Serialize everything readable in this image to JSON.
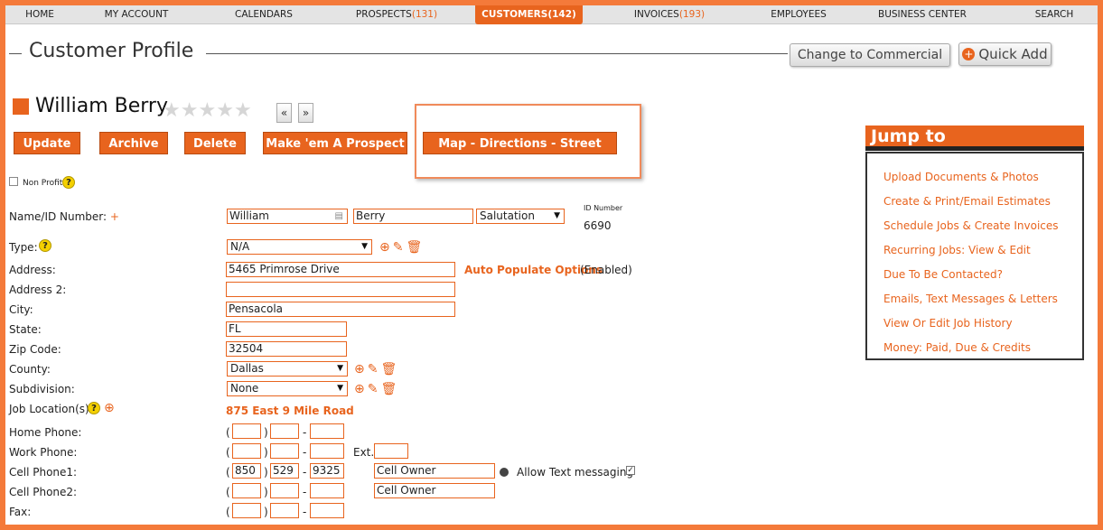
{
  "nav": {
    "items": [
      {
        "label": "HOME",
        "count": ""
      },
      {
        "label": "MY ACCOUNT",
        "count": ""
      },
      {
        "label": "CALENDARS",
        "count": ""
      },
      {
        "label": "PROSPECTS",
        "count": "(131)"
      },
      {
        "label": "CUSTOMERS",
        "count": "(142)"
      },
      {
        "label": "INVOICES",
        "count": "(193)"
      },
      {
        "label": "EMPLOYEES",
        "count": ""
      },
      {
        "label": "BUSINESS CENTER",
        "count": ""
      },
      {
        "label": "SEARCH",
        "count": ""
      }
    ],
    "active": "CUSTOMERS"
  },
  "page": {
    "title": "Customer Profile",
    "change_commercial_label": "Change to Commercial",
    "quick_add_label": "Quick Add"
  },
  "customer": {
    "name": "William Berry",
    "rating_stars": 0,
    "rating_max": 5,
    "prev_label": "«",
    "next_label": "»"
  },
  "actions": {
    "update": "Update",
    "archive": "Archive",
    "delete": "Delete",
    "make_prospect": "Make 'em A Prospect",
    "map": "Map - Directions - Street View"
  },
  "form": {
    "non_profit_label": "Non Profit",
    "name_label": "Name/ID Number:",
    "first_name": "William",
    "last_name": "Berry",
    "salutation": "Salutation",
    "id_number_label": "ID Number",
    "id_number": "6690",
    "type_label": "Type:",
    "type_value": "N/A",
    "address_label": "Address:",
    "address": "5465 Primrose Drive",
    "auto_populate": "Auto Populate Options",
    "auto_populate_status": "(Enabled)",
    "address2_label": "Address 2:",
    "address2": "",
    "city_label": "City:",
    "city": "Pensacola",
    "state_label": "State:",
    "state": "FL",
    "zip_label": "Zip Code:",
    "zip": "32504",
    "county_label": "County:",
    "county": "Dallas",
    "subdivision_label": "Subdivision:",
    "subdivision": "None",
    "job_location_label": "Job Location(s):",
    "job_location": "875 East 9 Mile Road",
    "home_phone_label": "Home Phone:",
    "work_phone_label": "Work Phone:",
    "ext_label": "Ext.",
    "cell1_label": "Cell Phone1:",
    "cell1_area": "850",
    "cell1_prefix": "529",
    "cell1_line": "9325",
    "cell1_owner": "Cell Owner",
    "allow_text_label": "Allow Text messaging",
    "cell2_label": "Cell Phone2:",
    "cell2_owner": "Cell Owner",
    "fax_label": "Fax:"
  },
  "jump": {
    "title": "Jump to",
    "links": [
      "Upload Documents & Photos",
      "Create & Print/Email Estimates",
      "Schedule Jobs & Create Invoices",
      "Recurring Jobs: View & Edit",
      "Due To Be Contacted?",
      "Emails, Text Messages & Letters",
      "View Or Edit Job History",
      "Money: Paid, Due & Credits"
    ]
  },
  "colors": {
    "accent": "#e8641e",
    "frame": "#f47a3a"
  }
}
